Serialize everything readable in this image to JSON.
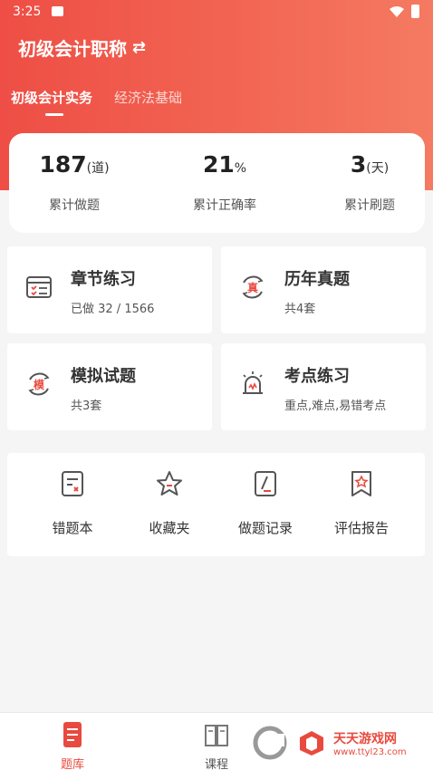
{
  "status_bar": {
    "time": "3:25"
  },
  "header": {
    "title": "初级会计职称",
    "switch_icon": "⇄"
  },
  "tabs": [
    {
      "label": "初级会计实务",
      "active": true
    },
    {
      "label": "经济法基础",
      "active": false
    }
  ],
  "stats": [
    {
      "value": "187",
      "unit": "(道)",
      "label": "累计做题"
    },
    {
      "value": "21",
      "unit": "%",
      "label": "累计正确率"
    },
    {
      "value": "3",
      "unit": "(天)",
      "label": "累计刷题"
    }
  ],
  "tiles": [
    {
      "title": "章节练习",
      "sub": "已做 32 / 1566",
      "icon": "chapter-list-icon"
    },
    {
      "title": "历年真题",
      "sub": "共4套",
      "icon": "zhen-icon",
      "glyph": "真"
    },
    {
      "title": "模拟试题",
      "sub": "共3套",
      "icon": "mo-icon",
      "glyph": "模"
    },
    {
      "title": "考点练习",
      "sub": "重点,难点,易错考点",
      "icon": "alarm-icon"
    }
  ],
  "tools": [
    {
      "label": "错题本",
      "icon": "error-book-icon"
    },
    {
      "label": "收藏夹",
      "icon": "star-icon"
    },
    {
      "label": "做题记录",
      "icon": "record-icon"
    },
    {
      "label": "评估报告",
      "icon": "report-icon"
    }
  ],
  "bottom_nav": [
    {
      "label": "题库",
      "active": true,
      "icon": "question-bank-icon"
    },
    {
      "label": "课程",
      "active": false,
      "icon": "course-book-icon"
    }
  ],
  "watermark": {
    "main": "天天游戏网",
    "url": "www.ttyl23.com"
  },
  "colors": {
    "accent": "#e84a3f",
    "header_gradient_start": "#ee4e45",
    "header_gradient_end": "#f57a62"
  }
}
